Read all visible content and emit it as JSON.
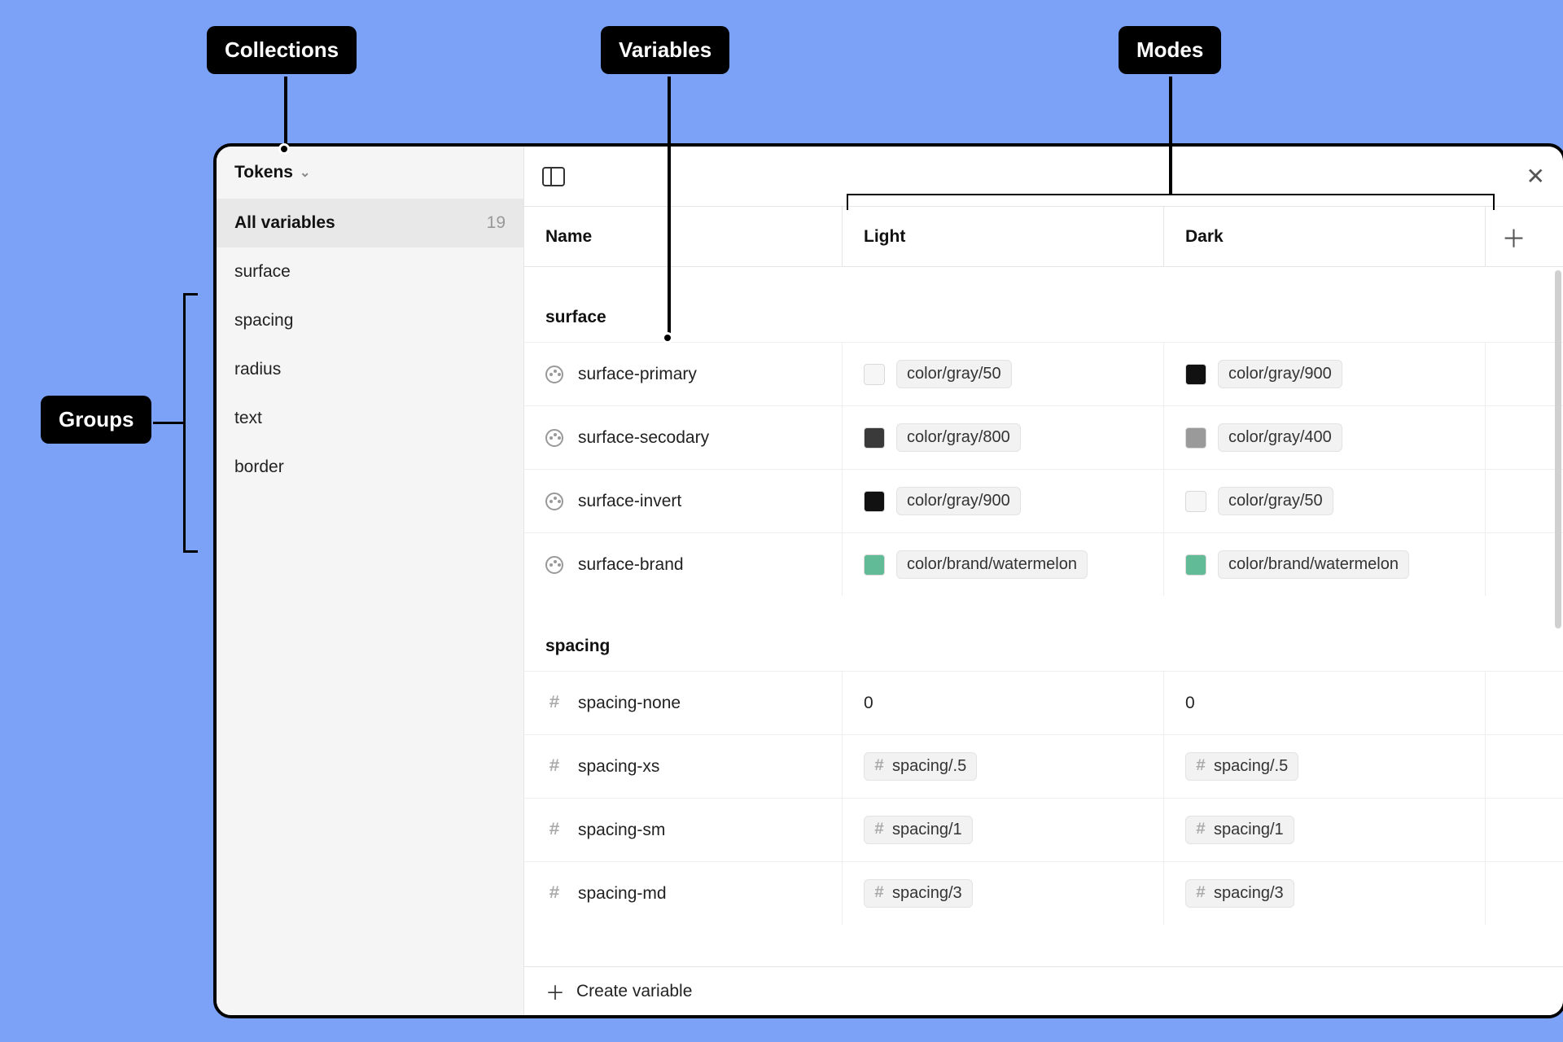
{
  "callouts": {
    "collections": "Collections",
    "variables": "Variables",
    "modes": "Modes",
    "groups": "Groups"
  },
  "sidebar": {
    "collection_name": "Tokens",
    "all_label": "All variables",
    "all_count": "19",
    "groups": [
      "surface",
      "spacing",
      "radius",
      "text",
      "border"
    ]
  },
  "table": {
    "columns": {
      "name": "Name",
      "mode1": "Light",
      "mode2": "Dark"
    },
    "sections": [
      {
        "title": "surface",
        "type": "color",
        "rows": [
          {
            "name": "surface-primary",
            "light": {
              "swatch": "#f6f6f6",
              "label": "color/gray/50"
            },
            "dark": {
              "swatch": "#111111",
              "label": "color/gray/900"
            }
          },
          {
            "name": "surface-secodary",
            "light": {
              "swatch": "#3a3a3a",
              "label": "color/gray/800"
            },
            "dark": {
              "swatch": "#9a9a9a",
              "label": "color/gray/400"
            }
          },
          {
            "name": "surface-invert",
            "light": {
              "swatch": "#111111",
              "label": "color/gray/900"
            },
            "dark": {
              "swatch": "#f6f6f6",
              "label": "color/gray/50"
            }
          },
          {
            "name": "surface-brand",
            "light": {
              "swatch": "#62bb97",
              "label": "color/brand/watermelon"
            },
            "dark": {
              "swatch": "#62bb97",
              "label": "color/brand/watermelon"
            }
          }
        ]
      },
      {
        "title": "spacing",
        "type": "number",
        "rows": [
          {
            "name": "spacing-none",
            "light": {
              "plain": "0"
            },
            "dark": {
              "plain": "0"
            }
          },
          {
            "name": "spacing-xs",
            "light": {
              "alias": "spacing/.5"
            },
            "dark": {
              "alias": "spacing/.5"
            }
          },
          {
            "name": "spacing-sm",
            "light": {
              "alias": "spacing/1"
            },
            "dark": {
              "alias": "spacing/1"
            }
          },
          {
            "name": "spacing-md",
            "light": {
              "alias": "spacing/3"
            },
            "dark": {
              "alias": "spacing/3"
            }
          }
        ]
      }
    ],
    "create_label": "Create variable"
  }
}
